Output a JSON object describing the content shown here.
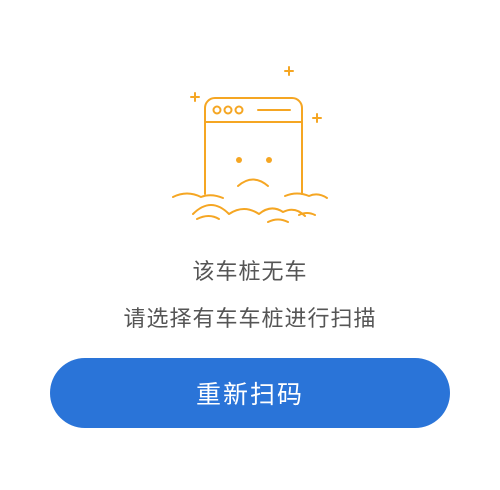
{
  "empty_state": {
    "icon": "sad-browser-window-icon",
    "accent_color": "#f5a623",
    "message_line_1": "该车桩无车",
    "message_line_2": "请选择有车车桩进行扫描"
  },
  "actions": {
    "rescan_label": "重新扫码",
    "button_color": "#2a74d8"
  }
}
